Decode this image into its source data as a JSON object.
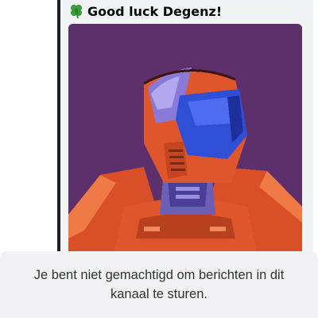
{
  "message": {
    "embed_title": "Good luck Degenz!",
    "title_icon": "four-leaf-clover-icon",
    "image_subject": "pixel-art-robot-avatar"
  },
  "colors": {
    "embed_background": "#f2f3f5",
    "embed_accent_bar": "#1e1f22",
    "image_background": "#5d2f6b",
    "armor_orange": "#e0562c",
    "visor_blue": "#2f4fd6",
    "helmet_purple": "#8a7ad8"
  },
  "composer": {
    "notice": "Je bent niet gemachtigd om berichten in dit kanaal te sturen."
  }
}
